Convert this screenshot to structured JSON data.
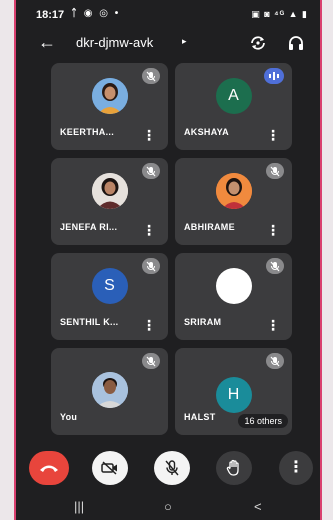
{
  "status": {
    "time": "18:17",
    "left_icons": "ᛏ ◉ ◎ •",
    "right_icons": "▣ ◙ ⁴ᴳ ▲ ▮"
  },
  "header": {
    "back_icon": "←",
    "meeting_code": "dkr-djmw-avk",
    "chevron": "▸"
  },
  "tiles": [
    {
      "name": "KEERTHA...",
      "avatar_type": "photo",
      "mic": "muted"
    },
    {
      "name": "AKSHAYA",
      "avatar_type": "letter",
      "initial": "A",
      "avatar_color": "#1c6e4e",
      "mic": "speaking"
    },
    {
      "name": "JENEFA RI...",
      "avatar_type": "photo",
      "mic": "muted"
    },
    {
      "name": "ABHIRAME",
      "avatar_type": "photo",
      "mic": "muted"
    },
    {
      "name": "SENTHIL K...",
      "avatar_type": "letter",
      "initial": "S",
      "avatar_color": "#2a5fb8",
      "mic": "muted"
    },
    {
      "name": "SRIRAM",
      "avatar_type": "blank",
      "avatar_color": "#ffffff",
      "mic": "muted"
    },
    {
      "name": "You",
      "avatar_type": "photo",
      "mic": "muted"
    },
    {
      "name": "HALST",
      "avatar_type": "letter",
      "initial": "H",
      "avatar_color": "#1a8c9a",
      "mic": "muted",
      "others_label": "16 others"
    }
  ],
  "controls": {
    "end_call_color": "#e8453c",
    "camera_off_icon": "camera-off-icon",
    "mic_off_icon": "mic-off-icon",
    "raise_hand_icon": "hand-icon",
    "more_icon": "more-vert-icon"
  },
  "navbar": {
    "recents": "|||",
    "home": "○",
    "back": "<"
  }
}
